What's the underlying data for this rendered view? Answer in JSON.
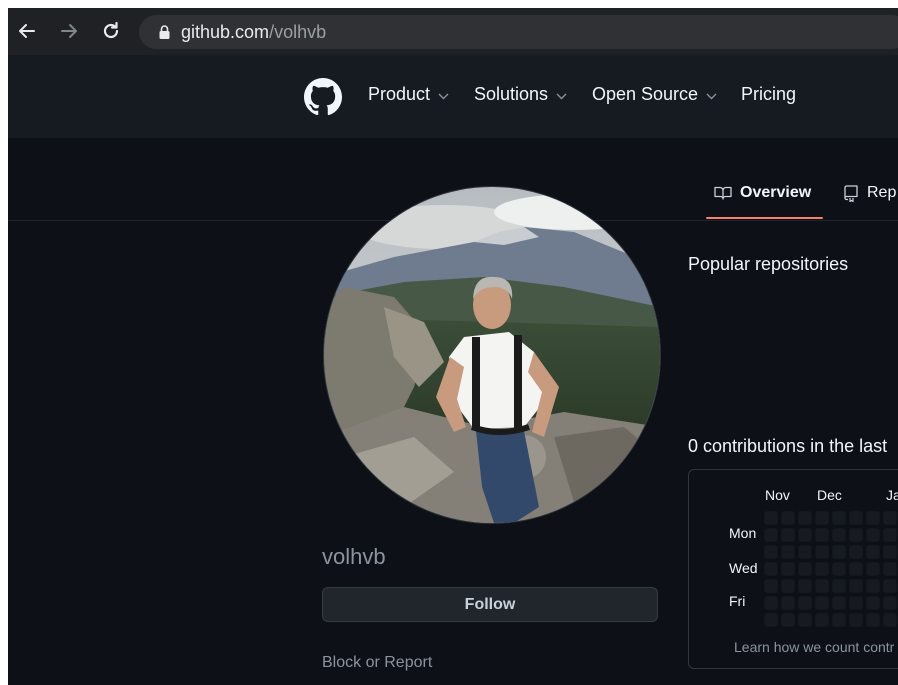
{
  "browser": {
    "url_domain": "github.com",
    "url_path": "/volhvb",
    "icons": [
      "back-arrow-icon",
      "forward-arrow-icon",
      "reload-icon",
      "lock-icon"
    ]
  },
  "header": {
    "nav": [
      "Product",
      "Solutions",
      "Open Source",
      "Pricing"
    ]
  },
  "tabs": {
    "overview": "Overview",
    "repositories": "Rep"
  },
  "profile": {
    "username": "volhvb",
    "follow_label": "Follow",
    "block_label": "Block or Report"
  },
  "main": {
    "popular_title": "Popular repositories",
    "contributions_title": "0 contributions in the last",
    "months": [
      "Nov",
      "Dec",
      "Ja"
    ],
    "days": [
      "Mon",
      "Wed",
      "Fri"
    ],
    "learn_text": "Learn how we count contr"
  },
  "colors": {
    "page_bg": "#0d1117",
    "header_bg": "#161b22",
    "tab_accent": "#f78166"
  }
}
